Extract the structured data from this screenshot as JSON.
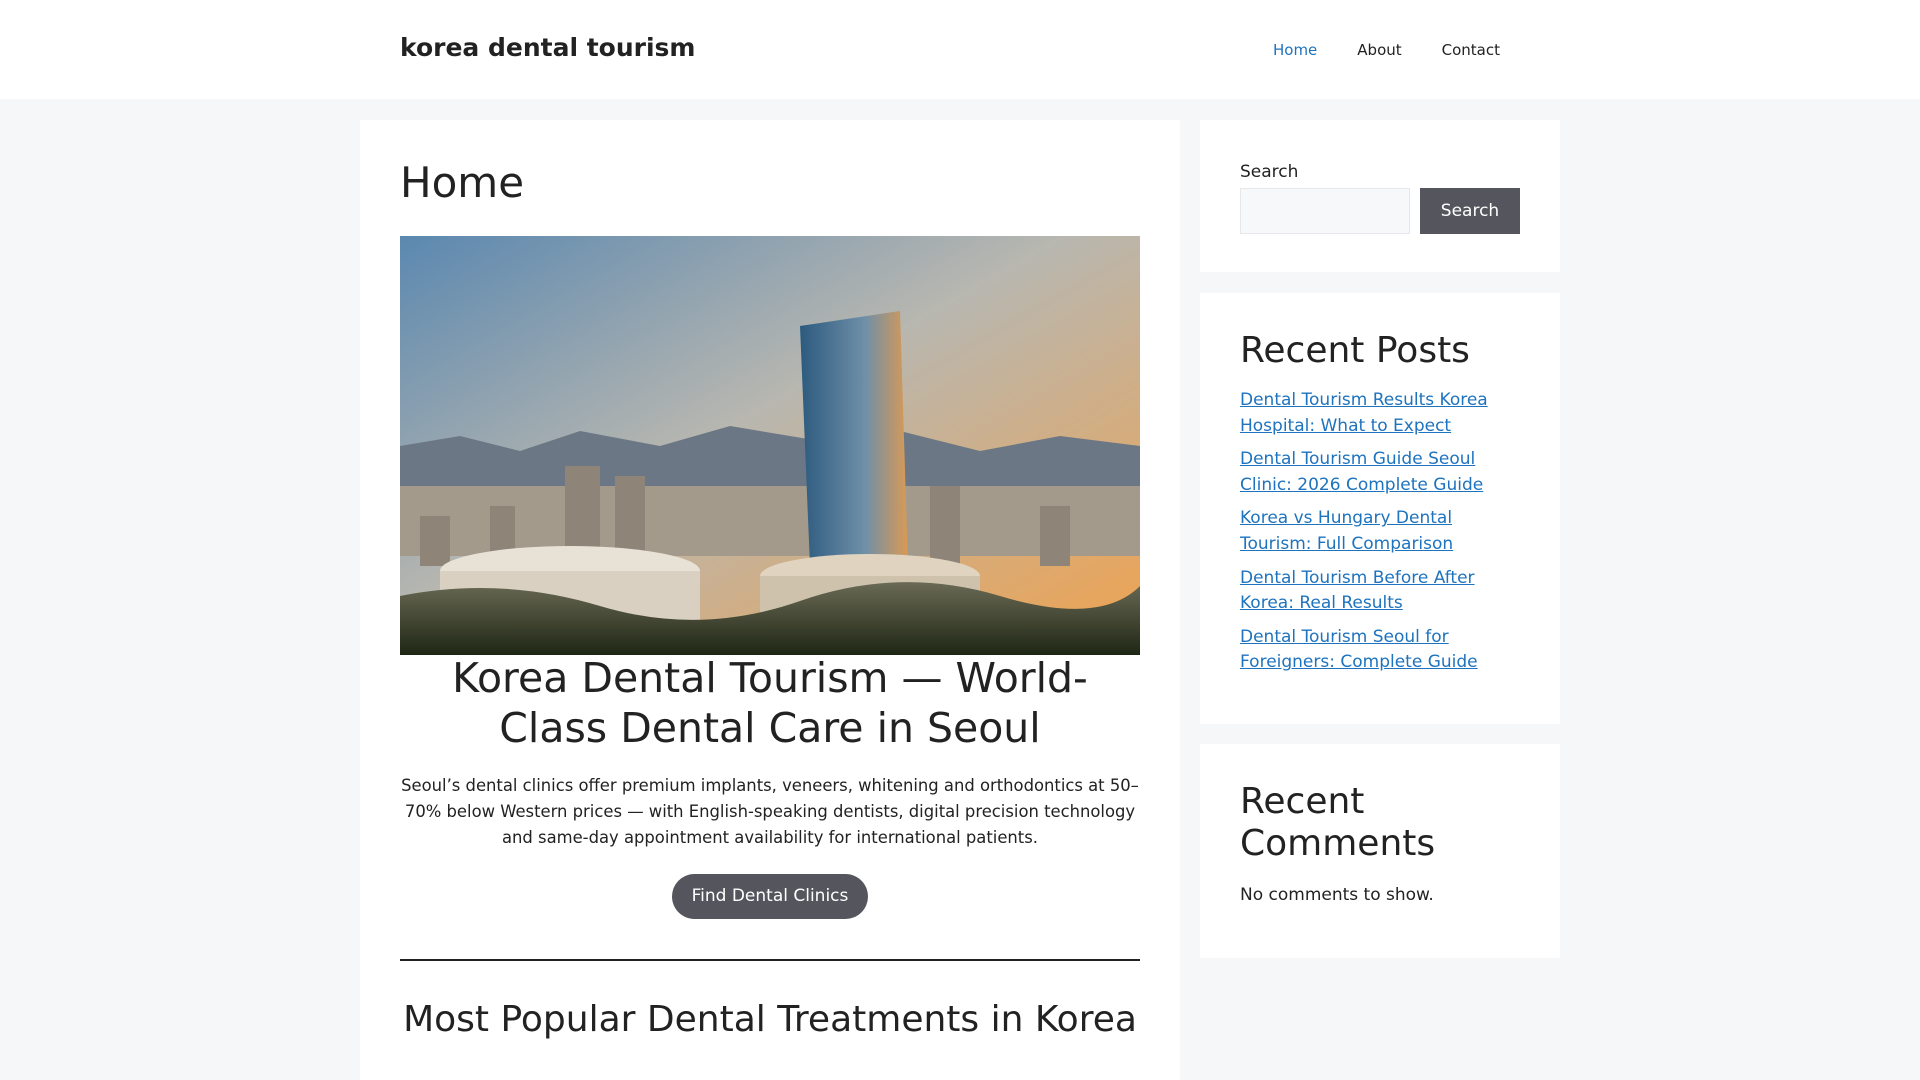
{
  "header": {
    "site_title": "korea dental tourism",
    "nav": [
      {
        "label": "Home",
        "active": true
      },
      {
        "label": "About"
      },
      {
        "label": "Contact"
      }
    ]
  },
  "main": {
    "page_title": "Home",
    "hero_image_alt": "Seoul hospital tower at sunset with mountains",
    "hero_title": "Korea Dental Tourism — World-Class Dental Care in Seoul",
    "hero_text": "Seoul’s dental clinics offer premium implants, veneers, whitening and orthodontics at 50–70% below Western prices — with English-speaking dentists, digital precision technology and same-day appointment availability for international patients.",
    "cta_label": "Find Dental Clinics",
    "section_title": "Most Popular Dental Treatments in Korea"
  },
  "sidebar": {
    "search": {
      "label": "Search",
      "value": "",
      "button": "Search"
    },
    "recent_posts": {
      "title": "Recent Posts",
      "items": [
        "Dental Tourism Results Korea Hospital: What to Expect",
        "Dental Tourism Guide Seoul Clinic: 2026 Complete Guide",
        "Korea vs Hungary Dental Tourism: Full Comparison",
        "Dental Tourism Before After Korea: Real Results",
        "Dental Tourism Seoul for Foreigners: Complete Guide"
      ]
    },
    "recent_comments": {
      "title": "Recent Comments",
      "empty": "No comments to show."
    }
  },
  "colors": {
    "link": "#1e73be",
    "button": "#55555e",
    "background": "#f6f7f9"
  }
}
